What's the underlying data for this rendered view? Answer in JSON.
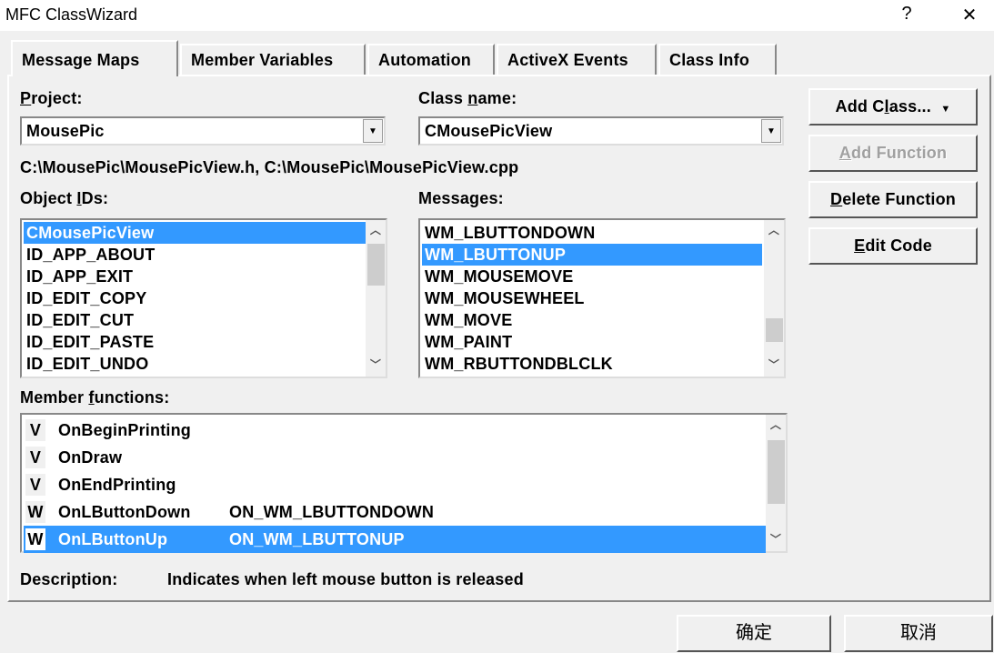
{
  "window": {
    "title": "MFC ClassWizard",
    "help": "?",
    "close": "✕"
  },
  "tabs": [
    {
      "label": "Message Maps",
      "selected": true
    },
    {
      "label": "Member Variables"
    },
    {
      "label": "Automation"
    },
    {
      "label": "ActiveX Events"
    },
    {
      "label": "Class Info"
    }
  ],
  "project": {
    "label": {
      "pre": "",
      "key": "P",
      "post": "roject:"
    },
    "value": "MousePic"
  },
  "class_name": {
    "label": {
      "pre": "Class ",
      "key": "n",
      "post": "ame:"
    },
    "value": "CMousePicView"
  },
  "files": "C:\\MousePic\\MousePicView.h, C:\\MousePic\\MousePicView.cpp",
  "object_ids": {
    "label": {
      "pre": "Object ",
      "key": "I",
      "post": "Ds:"
    },
    "items": [
      "CMousePicView",
      "ID_APP_ABOUT",
      "ID_APP_EXIT",
      "ID_EDIT_COPY",
      "ID_EDIT_CUT",
      "ID_EDIT_PASTE",
      "ID_EDIT_UNDO"
    ],
    "selected": 0
  },
  "messages": {
    "label": "Messages:",
    "items": [
      "WM_LBUTTONDOWN",
      "WM_LBUTTONUP",
      "WM_MOUSEMOVE",
      "WM_MOUSEWHEEL",
      "WM_MOVE",
      "WM_PAINT",
      "WM_RBUTTONDBLCLK"
    ],
    "selected": 1
  },
  "member_functions": {
    "label": {
      "pre": "Member ",
      "key": "f",
      "post": "unctions:"
    },
    "items": [
      {
        "type": "V",
        "name": "OnBeginPrinting",
        "macro": ""
      },
      {
        "type": "V",
        "name": "OnDraw",
        "macro": ""
      },
      {
        "type": "V",
        "name": "OnEndPrinting",
        "macro": ""
      },
      {
        "type": "W",
        "name": "OnLButtonDown",
        "macro": "ON_WM_LBUTTONDOWN"
      },
      {
        "type": "W",
        "name": "OnLButtonUp",
        "macro": "ON_WM_LBUTTONUP"
      }
    ],
    "selected": 4
  },
  "description": {
    "label": "Description:",
    "text": "Indicates when left mouse button is released"
  },
  "buttons": {
    "add_class": {
      "pre": "Add C",
      "key": "l",
      "post": "ass...",
      "arrow": "▼"
    },
    "add_function": {
      "pre": "",
      "key": "A",
      "post": "dd Function"
    },
    "delete_function": {
      "pre": "",
      "key": "D",
      "post": "elete Function"
    },
    "edit_code": {
      "pre": "",
      "key": "E",
      "post": "dit Code"
    },
    "ok": "确定",
    "cancel": "取消"
  },
  "colors": {
    "selection": "#3399ff",
    "face": "#f0f0f0"
  }
}
